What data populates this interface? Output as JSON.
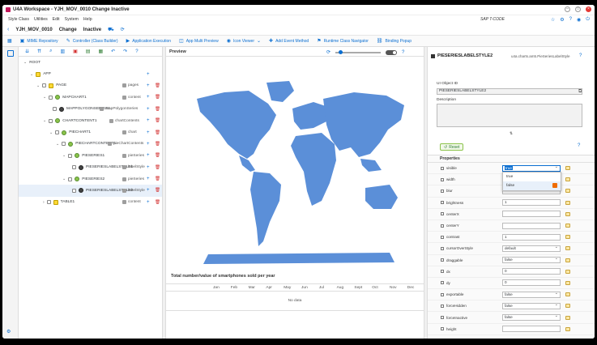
{
  "window": {
    "title": "U4A Workspace - YJH_MOV_0010 Change Inactive"
  },
  "menu": {
    "items": [
      "Style Class",
      "Utilities",
      "Edit",
      "System",
      "Help"
    ],
    "sap_tcode": "SAP T-CODE"
  },
  "header": {
    "app_id": "YJH_MOV_0010",
    "mode": "Change",
    "status": "Inactive"
  },
  "toolbar": {
    "items": [
      "MIME Repository",
      "Controller (Class Builder)",
      "Application Execution",
      "App Multi Preview",
      "Icon Viewer",
      "Add Event Method",
      "Runtime Class Navigator",
      "Binding Popup"
    ]
  },
  "tree": {
    "rows": [
      {
        "label": "ROOT",
        "agg": ""
      },
      {
        "label": "APP",
        "agg": ""
      },
      {
        "label": "PAGE",
        "agg": "pages"
      },
      {
        "label": "MAPCHART1",
        "agg": "content"
      },
      {
        "label": "MAPPOLYGONSERIES1",
        "agg": "mapPolygonSeries"
      },
      {
        "label": "CHARTCONTENT1",
        "agg": "chartContents"
      },
      {
        "label": "PIECHART1",
        "agg": "chart"
      },
      {
        "label": "PIECHARTCONTENT1",
        "agg": "pieChartContents"
      },
      {
        "label": "PIESERIES1",
        "agg": "pieSeries"
      },
      {
        "label": "PIESERIESLABELSTYLE1",
        "agg": "labelStyle"
      },
      {
        "label": "PIESERIES2",
        "agg": "pieSeries"
      },
      {
        "label": "PIESERIESLABELSTYLE2",
        "agg": "labelStyle"
      },
      {
        "label": "TABLE1",
        "agg": "content"
      }
    ]
  },
  "preview": {
    "title": "Preview",
    "chart_title": "Total number/value of smartphones sold per year",
    "months": [
      "Jan",
      "Feb",
      "Mar",
      "Apr",
      "May",
      "Jun",
      "Jul",
      "Aug",
      "Sept",
      "Oct",
      "Nov",
      "Dec"
    ],
    "no_data": "No data",
    "map_color": "#5b8fd8"
  },
  "panel": {
    "title": "PIESERIESLABELSTYLE2",
    "class": "u4a.charts.am5.PieSeriesLabelStyle",
    "ui_object_id_label": "UI Object ID",
    "ui_object_id": "PIESERIESLABELSTYLE2",
    "description_label": "Description",
    "reset": "Reset",
    "properties_label": "Properties",
    "properties": [
      {
        "name": "visible",
        "value": "true"
      },
      {
        "name": "width",
        "value": ""
      },
      {
        "name": "blur",
        "value": ""
      },
      {
        "name": "brightness",
        "value": "1"
      },
      {
        "name": "centerX",
        "value": ""
      },
      {
        "name": "centerY",
        "value": ""
      },
      {
        "name": "contrast",
        "value": "1"
      },
      {
        "name": "cursorOverStyle",
        "value": "default"
      },
      {
        "name": "draggable",
        "value": "false"
      },
      {
        "name": "dx",
        "value": "0"
      },
      {
        "name": "dy",
        "value": "0"
      },
      {
        "name": "exportable",
        "value": "false"
      },
      {
        "name": "forceHidden",
        "value": "false"
      },
      {
        "name": "forceInactive",
        "value": "false"
      },
      {
        "name": "height",
        "value": ""
      }
    ],
    "dropdown_options": [
      "true",
      "false"
    ]
  }
}
